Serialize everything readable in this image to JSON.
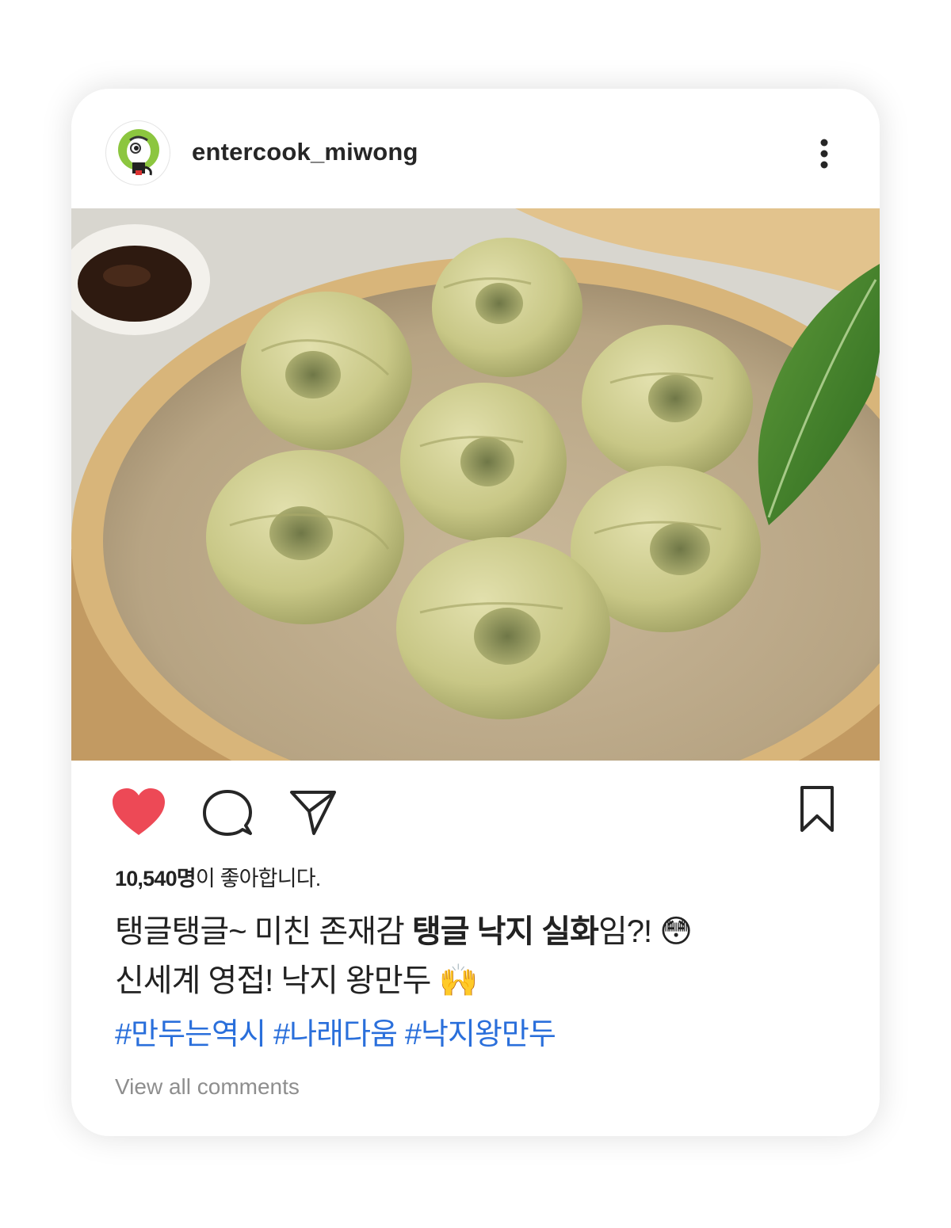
{
  "post": {
    "username": "entercook_miwong",
    "likes_count": "10,540명",
    "likes_suffix": "이 좋아합니다.",
    "caption_line1": {
      "part1": "탱글탱글~ 미친 존재감 ",
      "bold": "탱글 낙지 실화",
      "part2": "임?! ",
      "emoji": "😳"
    },
    "caption_line2": {
      "text": "신세계 영접! 낙지 왕만두 ",
      "emoji": "🙌"
    },
    "hashtags": [
      "#만두는역시",
      "#나래다움",
      "#낙지왕만두"
    ],
    "view_comments": "View all comments"
  },
  "icons": {
    "avatar": "cartoon-mascot-avatar",
    "more": "more-vertical-icon",
    "like": "heart-icon",
    "comment": "comment-bubble-icon",
    "share": "paper-plane-icon",
    "save": "bookmark-icon"
  },
  "colors": {
    "like_red": "#ed4956",
    "hashtag_blue": "#2a6fdb",
    "muted_gray": "#8e8e8e"
  }
}
